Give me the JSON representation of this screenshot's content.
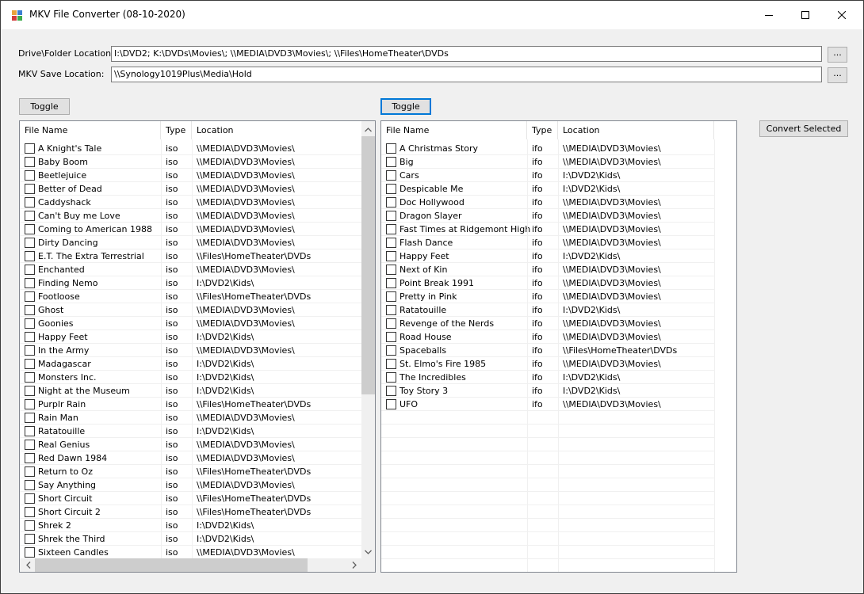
{
  "window": {
    "title": "MKV File Converter (08-10-2020)"
  },
  "form": {
    "drive_label": "Drive\\Folder Location:",
    "drive_value": "I:\\DVD2; K:\\DVDs\\Movies\\; \\\\MEDIA\\DVD3\\Movies\\; \\\\Files\\HomeTheater\\DVDs",
    "save_label": "MKV Save Location:",
    "save_value": "\\\\Synology1019Plus\\Media\\Hold",
    "browse_label": "...",
    "toggle_label": "Toggle",
    "convert_label": "Convert Selected"
  },
  "columns": {
    "name": "File Name",
    "type": "Type",
    "location": "Location"
  },
  "left_list": [
    {
      "name": "A Knight's Tale",
      "type": "iso",
      "location": "\\\\MEDIA\\DVD3\\Movies\\"
    },
    {
      "name": "Baby Boom",
      "type": "iso",
      "location": "\\\\MEDIA\\DVD3\\Movies\\"
    },
    {
      "name": "Beetlejuice",
      "type": "iso",
      "location": "\\\\MEDIA\\DVD3\\Movies\\"
    },
    {
      "name": "Better of Dead",
      "type": "iso",
      "location": "\\\\MEDIA\\DVD3\\Movies\\"
    },
    {
      "name": "Caddyshack",
      "type": "iso",
      "location": "\\\\MEDIA\\DVD3\\Movies\\"
    },
    {
      "name": "Can't Buy me Love",
      "type": "iso",
      "location": "\\\\MEDIA\\DVD3\\Movies\\"
    },
    {
      "name": "Coming to American 1988",
      "type": "iso",
      "location": "\\\\MEDIA\\DVD3\\Movies\\"
    },
    {
      "name": "Dirty Dancing",
      "type": "iso",
      "location": "\\\\MEDIA\\DVD3\\Movies\\"
    },
    {
      "name": "E.T. The Extra Terrestrial",
      "type": "iso",
      "location": "\\\\Files\\HomeTheater\\DVDs"
    },
    {
      "name": "Enchanted",
      "type": "iso",
      "location": "\\\\MEDIA\\DVD3\\Movies\\"
    },
    {
      "name": "Finding Nemo",
      "type": "iso",
      "location": "I:\\DVD2\\Kids\\"
    },
    {
      "name": "Footloose",
      "type": "iso",
      "location": "\\\\Files\\HomeTheater\\DVDs"
    },
    {
      "name": "Ghost",
      "type": "iso",
      "location": "\\\\MEDIA\\DVD3\\Movies\\"
    },
    {
      "name": "Goonies",
      "type": "iso",
      "location": "\\\\MEDIA\\DVD3\\Movies\\"
    },
    {
      "name": "Happy Feet",
      "type": "iso",
      "location": "I:\\DVD2\\Kids\\"
    },
    {
      "name": "In the Army",
      "type": "iso",
      "location": "\\\\MEDIA\\DVD3\\Movies\\"
    },
    {
      "name": "Madagascar",
      "type": "iso",
      "location": "I:\\DVD2\\Kids\\"
    },
    {
      "name": "Monsters Inc.",
      "type": "iso",
      "location": "I:\\DVD2\\Kids\\"
    },
    {
      "name": "Night at the Museum",
      "type": "iso",
      "location": "I:\\DVD2\\Kids\\"
    },
    {
      "name": "Purplr Rain",
      "type": "iso",
      "location": "\\\\Files\\HomeTheater\\DVDs"
    },
    {
      "name": "Rain Man",
      "type": "iso",
      "location": "\\\\MEDIA\\DVD3\\Movies\\"
    },
    {
      "name": "Ratatouille",
      "type": "iso",
      "location": "I:\\DVD2\\Kids\\"
    },
    {
      "name": "Real Genius",
      "type": "iso",
      "location": "\\\\MEDIA\\DVD3\\Movies\\"
    },
    {
      "name": "Red Dawn 1984",
      "type": "iso",
      "location": "\\\\MEDIA\\DVD3\\Movies\\"
    },
    {
      "name": "Return to Oz",
      "type": "iso",
      "location": "\\\\Files\\HomeTheater\\DVDs"
    },
    {
      "name": "Say Anything",
      "type": "iso",
      "location": "\\\\MEDIA\\DVD3\\Movies\\"
    },
    {
      "name": "Short Circuit",
      "type": "iso",
      "location": "\\\\Files\\HomeTheater\\DVDs"
    },
    {
      "name": "Short Circuit 2",
      "type": "iso",
      "location": "\\\\Files\\HomeTheater\\DVDs"
    },
    {
      "name": "Shrek 2",
      "type": "iso",
      "location": "I:\\DVD2\\Kids\\"
    },
    {
      "name": "Shrek the Third",
      "type": "iso",
      "location": "I:\\DVD2\\Kids\\"
    },
    {
      "name": "Sixteen Candles",
      "type": "iso",
      "location": "\\\\MEDIA\\DVD3\\Movies\\"
    }
  ],
  "right_list": [
    {
      "name": "A Christmas Story",
      "type": "ifo",
      "location": "\\\\MEDIA\\DVD3\\Movies\\"
    },
    {
      "name": "Big",
      "type": "ifo",
      "location": "\\\\MEDIA\\DVD3\\Movies\\"
    },
    {
      "name": "Cars",
      "type": "ifo",
      "location": "I:\\DVD2\\Kids\\"
    },
    {
      "name": "Despicable Me",
      "type": "ifo",
      "location": "I:\\DVD2\\Kids\\"
    },
    {
      "name": "Doc Hollywood",
      "type": "ifo",
      "location": "\\\\MEDIA\\DVD3\\Movies\\"
    },
    {
      "name": "Dragon Slayer",
      "type": "ifo",
      "location": "\\\\MEDIA\\DVD3\\Movies\\"
    },
    {
      "name": "Fast Times at Ridgemont High",
      "type": "ifo",
      "location": "\\\\MEDIA\\DVD3\\Movies\\"
    },
    {
      "name": "Flash Dance",
      "type": "ifo",
      "location": "\\\\MEDIA\\DVD3\\Movies\\"
    },
    {
      "name": "Happy Feet",
      "type": "ifo",
      "location": "I:\\DVD2\\Kids\\"
    },
    {
      "name": "Next of Kin",
      "type": "ifo",
      "location": "\\\\MEDIA\\DVD3\\Movies\\"
    },
    {
      "name": "Point Break 1991",
      "type": "ifo",
      "location": "\\\\MEDIA\\DVD3\\Movies\\"
    },
    {
      "name": "Pretty in Pink",
      "type": "ifo",
      "location": "\\\\MEDIA\\DVD3\\Movies\\"
    },
    {
      "name": "Ratatouille",
      "type": "ifo",
      "location": "I:\\DVD2\\Kids\\"
    },
    {
      "name": "Revenge of the Nerds",
      "type": "ifo",
      "location": "\\\\MEDIA\\DVD3\\Movies\\"
    },
    {
      "name": "Road House",
      "type": "ifo",
      "location": "\\\\MEDIA\\DVD3\\Movies\\"
    },
    {
      "name": "Spaceballs",
      "type": "ifo",
      "location": "\\\\Files\\HomeTheater\\DVDs"
    },
    {
      "name": "St. Elmo's Fire 1985",
      "type": "ifo",
      "location": "\\\\MEDIA\\DVD3\\Movies\\"
    },
    {
      "name": "The Incredibles",
      "type": "ifo",
      "location": "I:\\DVD2\\Kids\\"
    },
    {
      "name": "Toy Story 3",
      "type": "ifo",
      "location": "I:\\DVD2\\Kids\\"
    },
    {
      "name": "UFO",
      "type": "ifo",
      "location": "\\\\MEDIA\\DVD3\\Movies\\"
    }
  ]
}
